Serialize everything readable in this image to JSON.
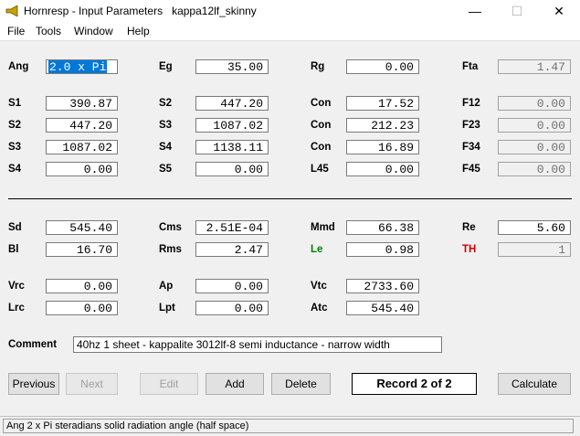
{
  "window": {
    "title": "Hornresp - Input Parameters",
    "record_name": "kappa12lf_skinny",
    "minimize": "—",
    "maximize": "☐",
    "close": "✕"
  },
  "menu": [
    "File",
    "Tools",
    "Window",
    "Help"
  ],
  "params": {
    "ang": {
      "label": "Ang",
      "value": "2.0 x Pi"
    },
    "eg": {
      "label": "Eg",
      "value": "35.00"
    },
    "rg": {
      "label": "Rg",
      "value": "0.00"
    },
    "fta": {
      "label": "Fta",
      "value": "1.47"
    },
    "s1a": {
      "label": "S1",
      "value": "390.87"
    },
    "s2a": {
      "label": "S2",
      "value": "447.20"
    },
    "con1": {
      "label": "Con",
      "value": "17.52"
    },
    "f12": {
      "label": "F12",
      "value": "0.00"
    },
    "s2b": {
      "label": "S2",
      "value": "447.20"
    },
    "s3a": {
      "label": "S3",
      "value": "1087.02"
    },
    "con2": {
      "label": "Con",
      "value": "212.23"
    },
    "f23": {
      "label": "F23",
      "value": "0.00"
    },
    "s3b": {
      "label": "S3",
      "value": "1087.02"
    },
    "s4a": {
      "label": "S4",
      "value": "1138.11"
    },
    "con3": {
      "label": "Con",
      "value": "16.89"
    },
    "f34": {
      "label": "F34",
      "value": "0.00"
    },
    "s4b": {
      "label": "S4",
      "value": "0.00"
    },
    "s5": {
      "label": "S5",
      "value": "0.00"
    },
    "l45": {
      "label": "L45",
      "value": "0.00"
    },
    "f45": {
      "label": "F45",
      "value": "0.00"
    },
    "sd": {
      "label": "Sd",
      "value": "545.40"
    },
    "cms": {
      "label": "Cms",
      "value": "2.51E-04"
    },
    "mmd": {
      "label": "Mmd",
      "value": "66.38"
    },
    "re": {
      "label": "Re",
      "value": "5.60"
    },
    "bl": {
      "label": "Bl",
      "value": "16.70"
    },
    "rms": {
      "label": "Rms",
      "value": "2.47"
    },
    "le": {
      "label": "Le",
      "value": "0.98",
      "color": "#008000"
    },
    "th": {
      "label": "TH",
      "value": "1",
      "color": "#d00000"
    },
    "vrc": {
      "label": "Vrc",
      "value": "0.00"
    },
    "ap": {
      "label": "Ap",
      "value": "0.00"
    },
    "vtc": {
      "label": "Vtc",
      "value": "2733.60"
    },
    "lrc": {
      "label": "Lrc",
      "value": "0.00"
    },
    "lpt": {
      "label": "Lpt",
      "value": "0.00"
    },
    "atc": {
      "label": "Atc",
      "value": "545.40"
    }
  },
  "comment": {
    "label": "Comment",
    "value": "40hz 1 sheet - kappalite 3012lf-8 semi inductance - narrow width"
  },
  "buttons": {
    "previous": "Previous",
    "next": "Next",
    "edit": "Edit",
    "add": "Add",
    "delete": "Delete",
    "calculate": "Calculate"
  },
  "record_status": "Record 2 of 2",
  "status_bar": "Ang   2 x Pi steradians solid radiation angle  (half space)"
}
